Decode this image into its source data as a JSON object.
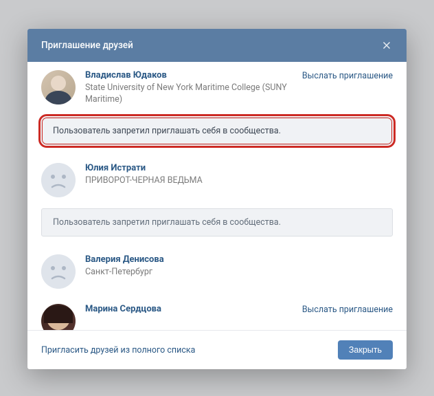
{
  "modal": {
    "title": "Приглашение друзей",
    "close_label": "Закрыть",
    "full_list_link": "Пригласить друзей из полного списка"
  },
  "invite_action": "Выслать приглашение",
  "blocked_notice": "Пользователь запретил приглашать себя в сообщества.",
  "friends": [
    {
      "name": "Владислав Юдаков",
      "subtitle": "State University of New York Maritime College (SUNY Maritime)"
    },
    {
      "name": "Юлия Истрати",
      "subtitle": "ПРИВОРОТ-ЧЕРНАЯ ВЕДЬМА"
    },
    {
      "name": "Валерия Денисова",
      "subtitle": "Санкт-Петербург"
    },
    {
      "name": "Марина Сердцова",
      "subtitle": ""
    }
  ]
}
